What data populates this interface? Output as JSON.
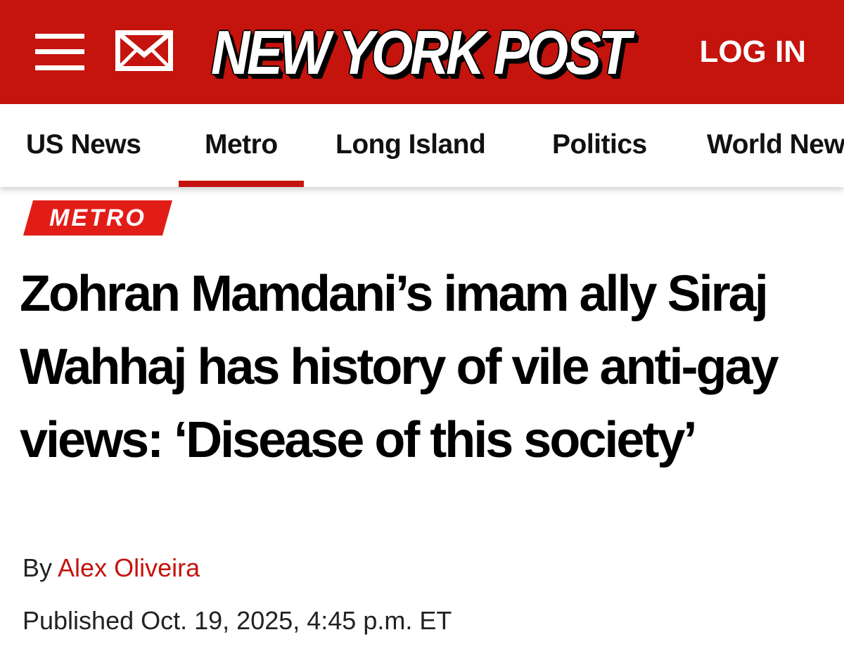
{
  "header": {
    "logo_text": "NEW YORK POST",
    "login_label": "LOG IN",
    "menu_icon": "hamburger-menu-icon",
    "mail_icon": "envelope-icon",
    "background_color": "#c4140d"
  },
  "nav": {
    "items": [
      {
        "label": "US News"
      },
      {
        "label": "Metro",
        "active": true
      },
      {
        "label": "Long Island"
      },
      {
        "label": "Politics"
      },
      {
        "label": "World News"
      }
    ],
    "active_color": "#c4140d"
  },
  "article": {
    "section": "METRO",
    "headline": "Zohran Mamdani’s imam ally Siraj Wahhaj has history of vile anti-gay views: ‘Disease of this society’",
    "byline_prefix": "By",
    "author": "Alex Oliveira",
    "published": "Published Oct. 19, 2025, 4:45 p.m. ET",
    "accent_color": "#e21d18"
  }
}
